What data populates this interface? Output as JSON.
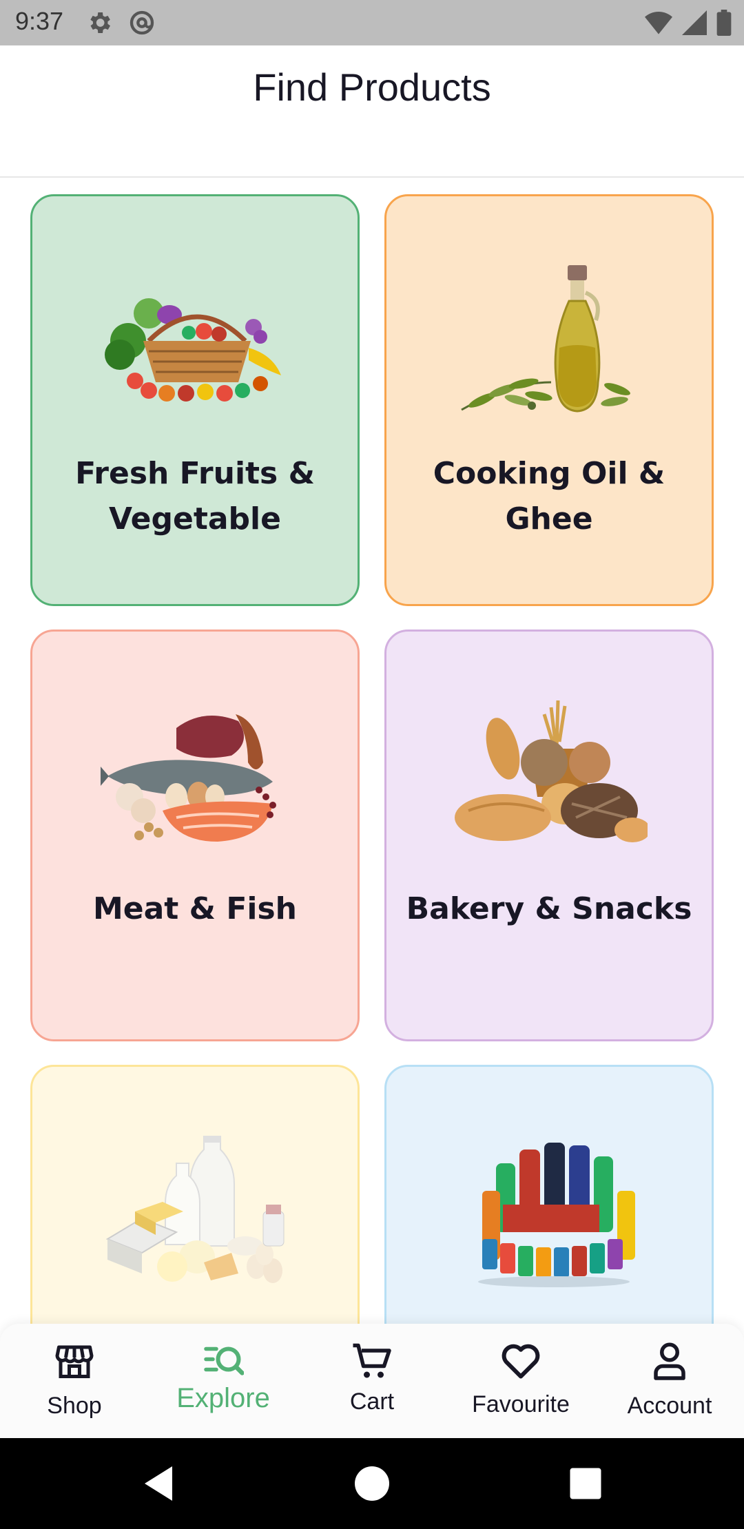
{
  "status_bar": {
    "time": "9:37",
    "icons_left": [
      "settings-icon",
      "at-sign-icon"
    ],
    "icons_right": [
      "wifi-icon",
      "signal-icon",
      "battery-icon"
    ]
  },
  "header": {
    "title": "Find Products"
  },
  "categories": [
    {
      "label": "Fresh Fruits & Vegetable",
      "bg": "#cfe8d6",
      "border": "#53b175",
      "icon": "fruit-basket-image"
    },
    {
      "label": "Cooking Oil & Ghee",
      "bg": "#fde5c8",
      "border": "#f8a44c",
      "icon": "olive-oil-bottle-image"
    },
    {
      "label": "Meat & Fish",
      "bg": "#fde1dd",
      "border": "#f7a593",
      "icon": "meat-fish-image"
    },
    {
      "label": "Bakery & Snacks",
      "bg": "#f1e4f7",
      "border": "#d3b0e0",
      "icon": "bread-basket-image"
    },
    {
      "label": "",
      "bg": "#fff8e2",
      "border": "#fde598",
      "icon": "dairy-eggs-image"
    },
    {
      "label": "",
      "bg": "#e6f2fb",
      "border": "#b7dff5",
      "icon": "soft-drinks-image"
    }
  ],
  "bottom_nav": {
    "items": [
      {
        "label": "Shop",
        "icon": "store-icon",
        "active": false
      },
      {
        "label": "Explore",
        "icon": "explore-search-icon",
        "active": true
      },
      {
        "label": "Cart",
        "icon": "cart-icon",
        "active": false
      },
      {
        "label": "Favourite",
        "icon": "heart-icon",
        "active": false
      },
      {
        "label": "Account",
        "icon": "person-icon",
        "active": false
      }
    ],
    "active_color": "#53b175"
  },
  "system_nav": [
    "back-icon",
    "home-icon",
    "recents-icon"
  ]
}
